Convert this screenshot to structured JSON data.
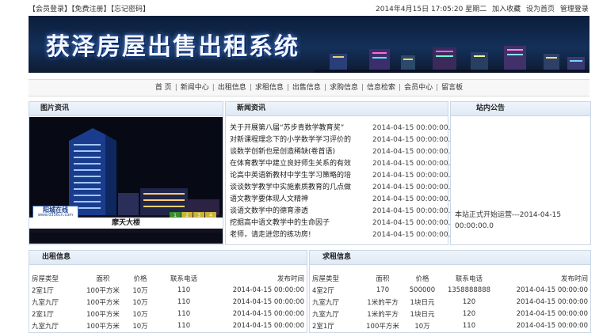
{
  "top": {
    "login": "【会员登录】",
    "register": "【免费注册】",
    "forgot": "【忘记密码】",
    "datetime": "2014年4月15日 17:05:20 星期二",
    "favorite": "加入收藏",
    "homepage": "设为首页",
    "admin": "管理登录"
  },
  "banner": {
    "title": "获泽房屋出售出租系统"
  },
  "nav": [
    "首 页",
    "新闻中心",
    "出租信息",
    "求租信息",
    "出售信息",
    "求购信息",
    "信息检索",
    "会员中心",
    "留言板"
  ],
  "pic": {
    "header": "图片资讯",
    "caption": "摩天大楼",
    "logo_text": "阳城在线",
    "logo_url": "www.0356cn.com",
    "pages": [
      "1",
      "2",
      "3",
      "4"
    ]
  },
  "news": {
    "header": "新闻资讯",
    "items": [
      {
        "title": "关于开展第八届“苏步青数学教育奖”",
        "date": "2014-04-15 00:00:00.0"
      },
      {
        "title": "对新课程理念下的小学数学学习评价的",
        "date": "2014-04-15 00:00:00.0"
      },
      {
        "title": "谈数学创新也是创造稀缺(卷首语)",
        "date": "2014-04-15 00:00:00.0"
      },
      {
        "title": "在体育教学中建立良好师生关系的有效",
        "date": "2014-04-15 00:00:00.0"
      },
      {
        "title": "论高中英语新教材中学生学习策略的培",
        "date": "2014-04-15 00:00:00.0"
      },
      {
        "title": "谈谈数学教学中实施素质教育的几点做",
        "date": "2014-04-15 00:00:00.0"
      },
      {
        "title": "语文教学要体现人文精神",
        "date": "2014-04-15 00:00:00.0"
      },
      {
        "title": "谈语文数学中的德育渗透",
        "date": "2014-04-15 00:00:00.0"
      },
      {
        "title": "挖掘高中语文教学中的生命因子",
        "date": "2014-04-15 00:00:00.0"
      },
      {
        "title": "老师，请走进您的练功房!",
        "date": "2014-04-15 00:00:00.0"
      }
    ]
  },
  "notice": {
    "header": "站内公告",
    "text": "本站正式开始运营---2014-04-15 00:00:00.0"
  },
  "rent": {
    "header": "出租信息",
    "columns": [
      "房屋类型",
      "面积",
      "价格",
      "联系电话",
      "发布时间"
    ],
    "rows": [
      [
        "2室1厅",
        "100平方米",
        "10万",
        "110",
        "2014-04-15 00:00:00"
      ],
      [
        "九室九厅",
        "100平方米",
        "10万",
        "110",
        "2014-04-15 00:00:00"
      ],
      [
        "2室1厅",
        "100平方米",
        "10万",
        "110",
        "2014-04-15 00:00:00"
      ],
      [
        "九室九厅",
        "100平方米",
        "10万",
        "110",
        "2014-04-15 00:00:00"
      ]
    ]
  },
  "want": {
    "header": "求租信息",
    "columns": [
      "房屋类型",
      "面积",
      "价格",
      "联系电话",
      "发布时间"
    ],
    "rows": [
      [
        "4室2厅",
        "170",
        "500000",
        "1358888888",
        "2014-04-15 00:00:00"
      ],
      [
        "九室九厅",
        "1米的平方",
        "1块日元",
        "120",
        "2014-04-15 00:00:00"
      ],
      [
        "九室九厅",
        "1米的平方",
        "1块日元",
        "120",
        "2014-04-15 00:00:00"
      ],
      [
        "2室1厅",
        "100平方米",
        "10万",
        "110",
        "2014-04-15 00:00:00"
      ]
    ]
  },
  "colors": {
    "panel_border": "#c9d6e6",
    "header_bg": "#dfe9f5",
    "banner_bg": "#14305a"
  }
}
